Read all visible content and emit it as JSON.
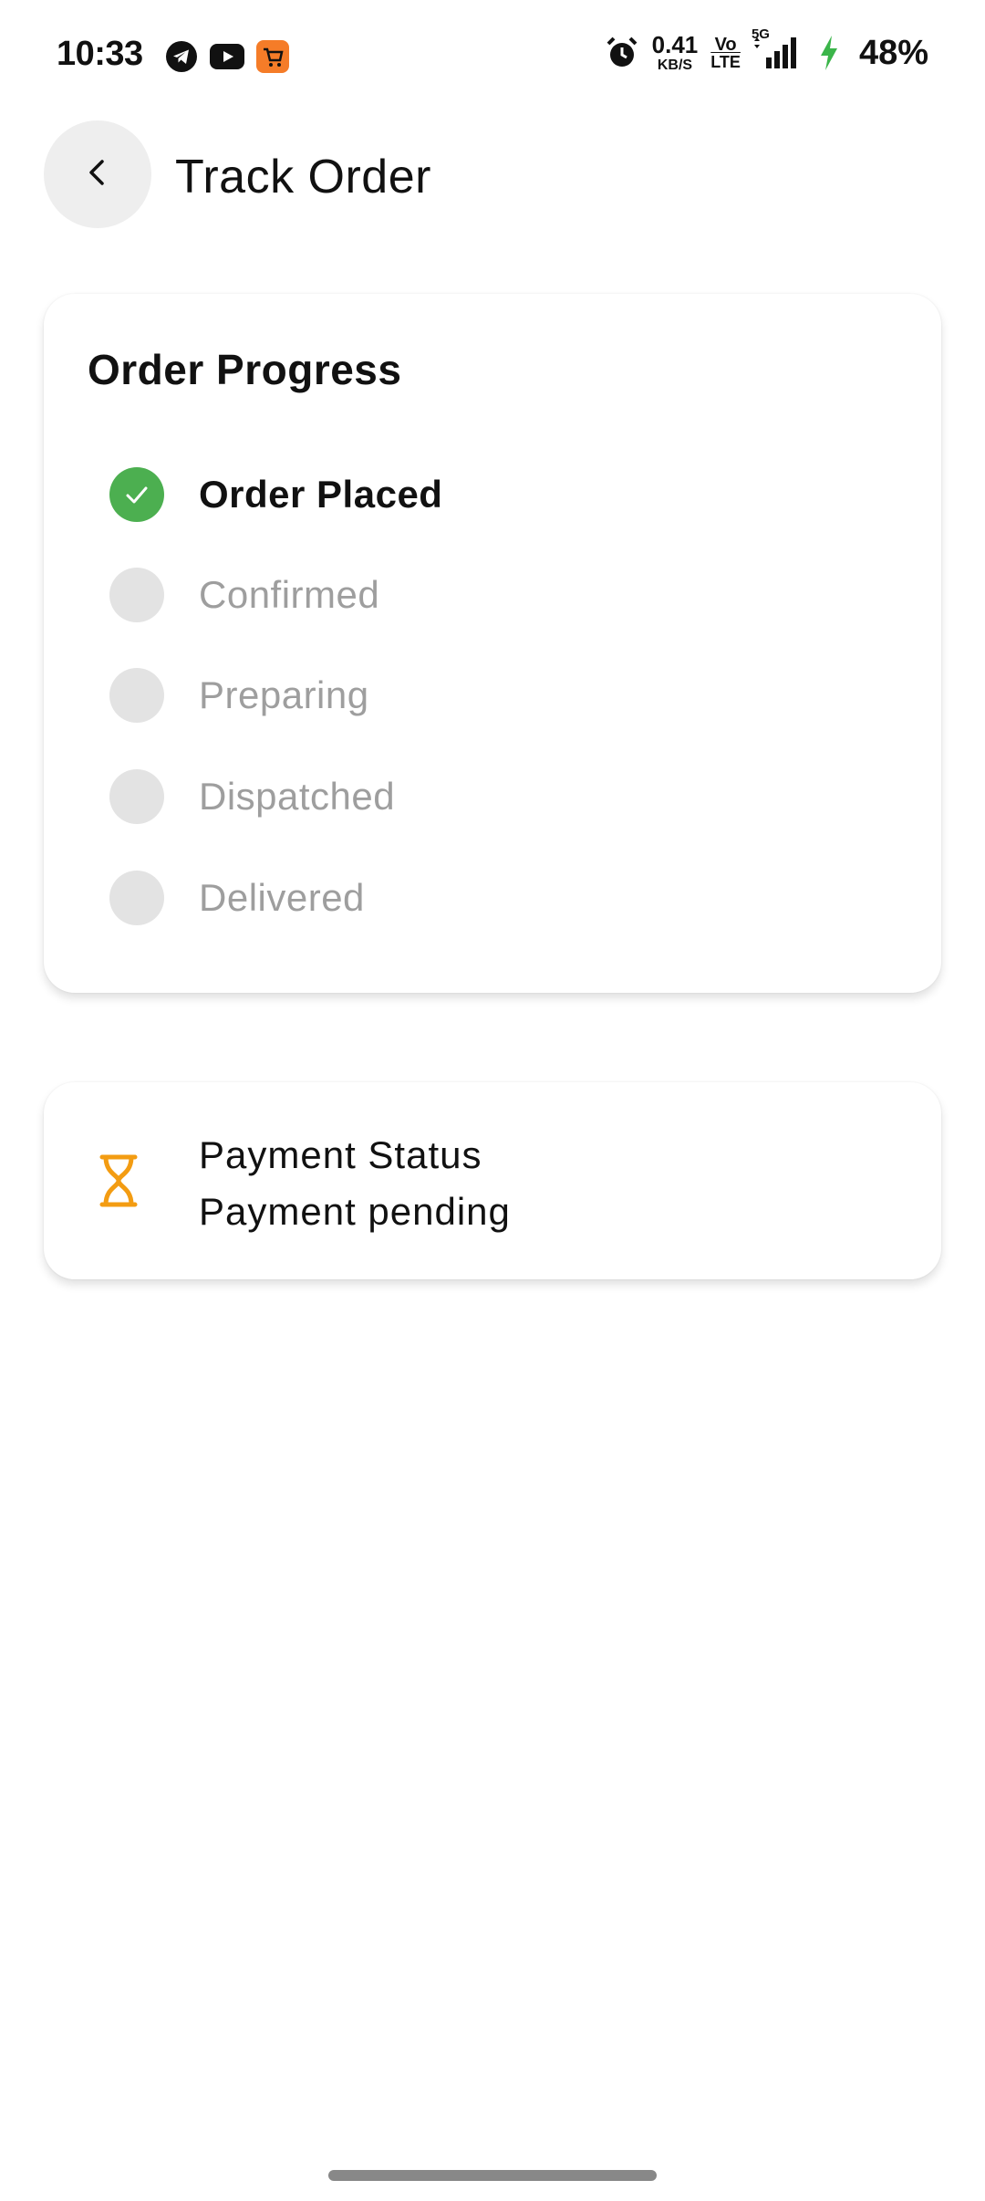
{
  "status_bar": {
    "time": "10:33",
    "net_speed_value": "0.41",
    "net_speed_unit": "KB/S",
    "volte_top": "Vo",
    "volte_bottom": "LTE",
    "network_type": "5G",
    "battery_percent": "48%",
    "icons": [
      "telegram-icon",
      "youtube-icon",
      "shopping-cart-app-icon",
      "alarm-icon",
      "signal-icon",
      "charging-icon"
    ]
  },
  "header": {
    "title": "Track Order",
    "back_icon": "chevron-left-icon"
  },
  "progress": {
    "title": "Order Progress",
    "steps": [
      {
        "label": "Order Placed",
        "state": "done"
      },
      {
        "label": "Confirmed",
        "state": "pending"
      },
      {
        "label": "Preparing",
        "state": "pending"
      },
      {
        "label": "Dispatched",
        "state": "pending"
      },
      {
        "label": "Delivered",
        "state": "pending"
      }
    ]
  },
  "payment": {
    "title": "Payment Status",
    "value": "Payment pending",
    "icon": "hourglass-icon"
  },
  "colors": {
    "done_green": "#4caf50",
    "pending_gray": "#e3e3e3",
    "pending_text": "#9e9e9e",
    "hourglass_orange": "#f39c12"
  }
}
